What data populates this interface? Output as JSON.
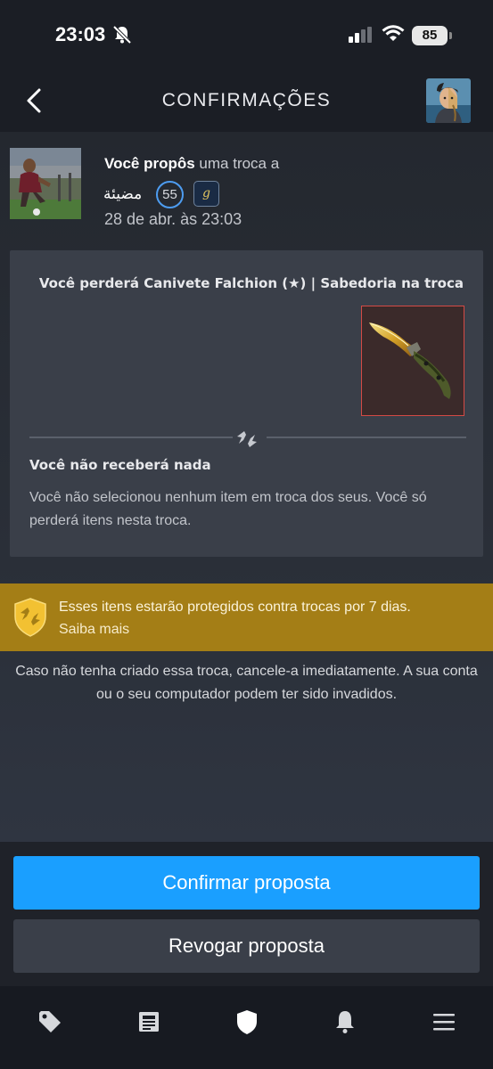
{
  "status_bar": {
    "time": "23:03",
    "battery": "85"
  },
  "header": {
    "title": "CONFIRMAÇÕES"
  },
  "trade": {
    "proposal_bold": "Você propôs",
    "proposal_rest": " uma troca a",
    "partner_name": "مضيئة",
    "partner_level": "55",
    "game_icon_letter": "g",
    "date": "28 de abr. às 23:03",
    "lose_title": "Você perderá Canivete Falchion (★) | Sabedoria na troca",
    "receive_title": "Você não receberá nada",
    "receive_desc": "Você não selecionou nenhum item em troca dos seus. Você só perderá itens nesta troca."
  },
  "protection": {
    "text": "Esses itens estarão protegidos contra trocas por 7 dias.",
    "link": "Saiba mais"
  },
  "warning": "Caso não tenha criado essa troca, cancele-a imediatamente. A sua conta ou o seu computador podem ter sido invadidos.",
  "actions": {
    "confirm_label": "Confirmar proposta",
    "revoke_label": "Revogar proposta"
  },
  "bottom_nav": {
    "items": [
      "tag-icon",
      "news-icon",
      "shield-icon",
      "bell-icon",
      "menu-icon"
    ]
  },
  "colors": {
    "accent": "#1a9fff",
    "protection_banner": "#a47e16",
    "item_border": "#d44a45",
    "level_ring": "#4d9cf0"
  }
}
